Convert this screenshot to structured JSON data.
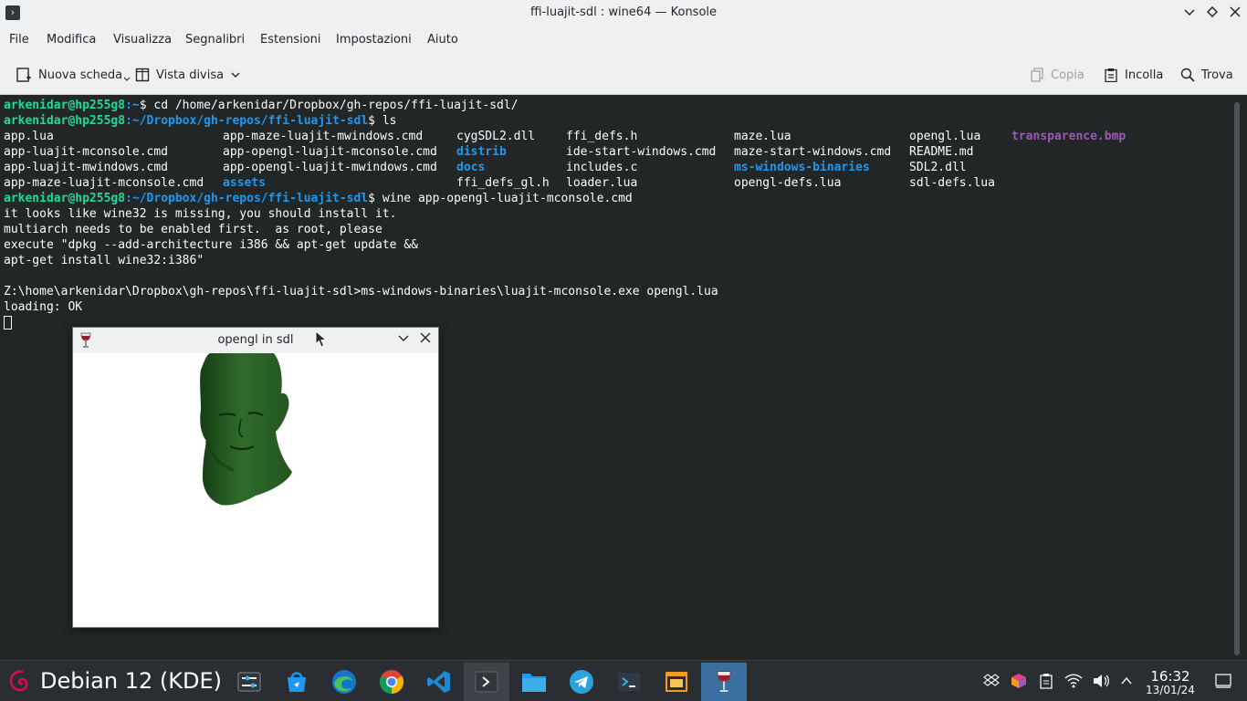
{
  "window": {
    "title": "ffi-luajit-sdl : wine64 — Konsole",
    "app_icon": "terminal-icon",
    "controls": [
      "chevron-down-icon",
      "diamond-icon",
      "close-icon"
    ]
  },
  "menubar": {
    "items": [
      "File",
      "Modifica",
      "Visualizza",
      "Segnalibri",
      "Estensioni",
      "Impostazioni",
      "Aiuto"
    ]
  },
  "toolbar": {
    "new_tab": "Nuova scheda",
    "split_view": "Vista divisa",
    "copy": "Copia",
    "paste": "Incolla",
    "find": "Trova"
  },
  "terminal": {
    "line1": {
      "user": "arkenidar@hp255g8",
      "path": ":~",
      "cmd": "$ cd /home/arkenidar/Dropbox/gh-repos/ffi-luajit-sdl/"
    },
    "line2": {
      "user": "arkenidar@hp255g8",
      "path": ":~/Dropbox/gh-repos/ffi-luajit-sdl",
      "cmd": "$ ls"
    },
    "ls": [
      [
        "app.lua",
        "app-maze-luajit-mwindows.cmd",
        "cygSDL2.dll",
        "ffi_defs.h",
        "maze.lua",
        "opengl.lua",
        "transparence.bmp"
      ],
      [
        "app-luajit-mconsole.cmd",
        "app-opengl-luajit-mconsole.cmd",
        "distrib",
        "ide-start-windows.cmd",
        "maze-start-windows.cmd",
        "README.md",
        ""
      ],
      [
        "app-luajit-mwindows.cmd",
        "app-opengl-luajit-mwindows.cmd",
        "docs",
        "includes.c",
        "ms-windows-binaries",
        "SDL2.dll",
        ""
      ],
      [
        "app-maze-luajit-mconsole.cmd",
        "assets",
        "ffi_defs_gl.h",
        "loader.lua",
        "opengl-defs.lua",
        "sdl-defs.lua",
        ""
      ]
    ],
    "line7": {
      "user": "arkenidar@hp255g8",
      "path": ":~/Dropbox/gh-repos/ffi-luajit-sdl",
      "cmd": "$ wine app-opengl-luajit-mconsole.cmd"
    },
    "out1": "it looks like wine32 is missing, you should install it.",
    "out2": "multiarch needs to be enabled first.  as root, please",
    "out3": "execute \"dpkg --add-architecture i386 && apt-get update &&",
    "out4": "apt-get install wine32:i386\"",
    "out5": "Z:\\home\\arkenidar\\Dropbox\\gh-repos\\ffi-luajit-sdl>ms-windows-binaries\\luajit-mconsole.exe opengl.lua",
    "out6": "loading: OK"
  },
  "sdl_window": {
    "title": "opengl in sdl",
    "icon": "wine-glass-icon",
    "controls": [
      "chevron-down-icon",
      "close-icon"
    ],
    "model_color": "#2e6b2a"
  },
  "taskbar": {
    "start_label": "Debian 12 (KDE)",
    "start_icon": "debian-swirl-icon",
    "tasks": [
      "settings-icon",
      "discover-store-icon",
      "edge-icon",
      "chrome-icon",
      "vscode-icon",
      "konsole-icon",
      "files-icon",
      "telegram-icon",
      "terminal-alt-icon",
      "app-window-icon",
      "wine-glass-icon"
    ],
    "tray": [
      "dropbox-icon",
      "color-cube-icon",
      "clipboard-icon",
      "wifi-icon",
      "volume-icon",
      "chevron-up-icon"
    ],
    "time": "16:32",
    "date": "13/01/24",
    "show_desktop": "show-desktop-icon"
  },
  "colors": {
    "terminal_bg": "#232627",
    "prompt_user": "#1cdc9a",
    "prompt_path": "#1d99f3",
    "dir": "#1d99f3",
    "image_file": "#9b59b6"
  }
}
